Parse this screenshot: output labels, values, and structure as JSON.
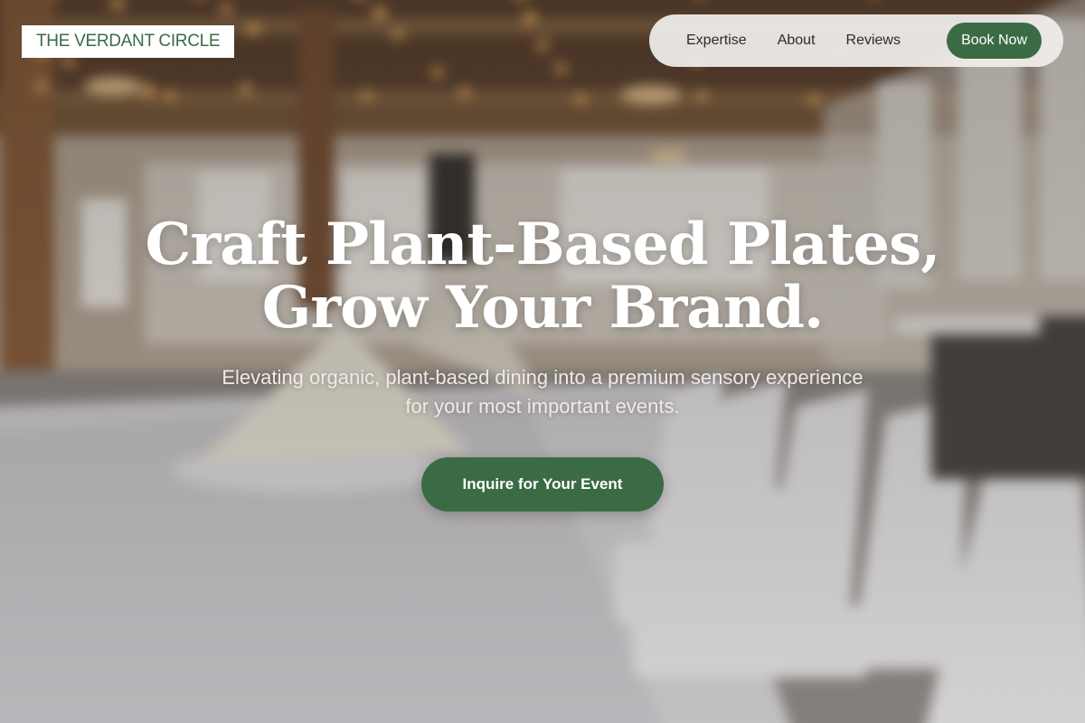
{
  "brand": {
    "name": "THE VERDANT CIRCLE",
    "accent_color": "#3b6b45"
  },
  "nav": {
    "links": [
      {
        "label": "Expertise"
      },
      {
        "label": "About"
      },
      {
        "label": "Reviews"
      }
    ],
    "cta_label": "Book Now"
  },
  "hero": {
    "title_line1": "Craft Plant-Based Plates,",
    "title_line2": "Grow Your Brand.",
    "subtitle_line1": "Elevating organic, plant-based dining into a premium sensory experience",
    "subtitle_line2": "for your most important events.",
    "cta_label": "Inquire for Your Event",
    "background_image": "blurred banquet hall with long white-clothed table, folded napkins on plates and rows of white chairs"
  }
}
